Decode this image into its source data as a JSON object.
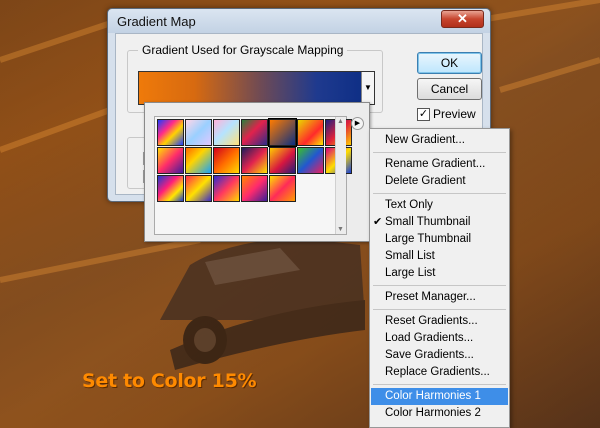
{
  "dialog": {
    "title": "Gradient Map",
    "close_glyph": "✕",
    "group_label": "Gradient Used for Grayscale Mapping",
    "ok_label": "OK",
    "cancel_label": "Cancel",
    "preview_label": "Preview",
    "preview_checked": true,
    "gradient_colors": [
      "#ef7a0a",
      "#0f2f86"
    ]
  },
  "picker": {
    "flyout_glyph": "▶",
    "thumbnail_count": 19
  },
  "menu": {
    "items": [
      {
        "label": "New Gradient...",
        "checked": false,
        "highlighted": false
      },
      {
        "label": "Rename Gradient...",
        "checked": false,
        "highlighted": false
      },
      {
        "label": "Delete Gradient",
        "checked": false,
        "highlighted": false
      },
      {
        "label": "Text Only",
        "checked": false,
        "highlighted": false
      },
      {
        "label": "Small Thumbnail",
        "checked": true,
        "highlighted": false
      },
      {
        "label": "Large Thumbnail",
        "checked": false,
        "highlighted": false
      },
      {
        "label": "Small List",
        "checked": false,
        "highlighted": false
      },
      {
        "label": "Large List",
        "checked": false,
        "highlighted": false
      },
      {
        "label": "Preset Manager...",
        "checked": false,
        "highlighted": false
      },
      {
        "label": "Reset Gradients...",
        "checked": false,
        "highlighted": false
      },
      {
        "label": "Load Gradients...",
        "checked": false,
        "highlighted": false
      },
      {
        "label": "Save Gradients...",
        "checked": false,
        "highlighted": false
      },
      {
        "label": "Replace Gradients...",
        "checked": false,
        "highlighted": false
      },
      {
        "label": "Color Harmonies 1",
        "checked": false,
        "highlighted": true
      },
      {
        "label": "Color Harmonies 2",
        "checked": false,
        "highlighted": false
      }
    ],
    "accent": "#3e8ee8"
  },
  "caption": "Set to Color 15%"
}
